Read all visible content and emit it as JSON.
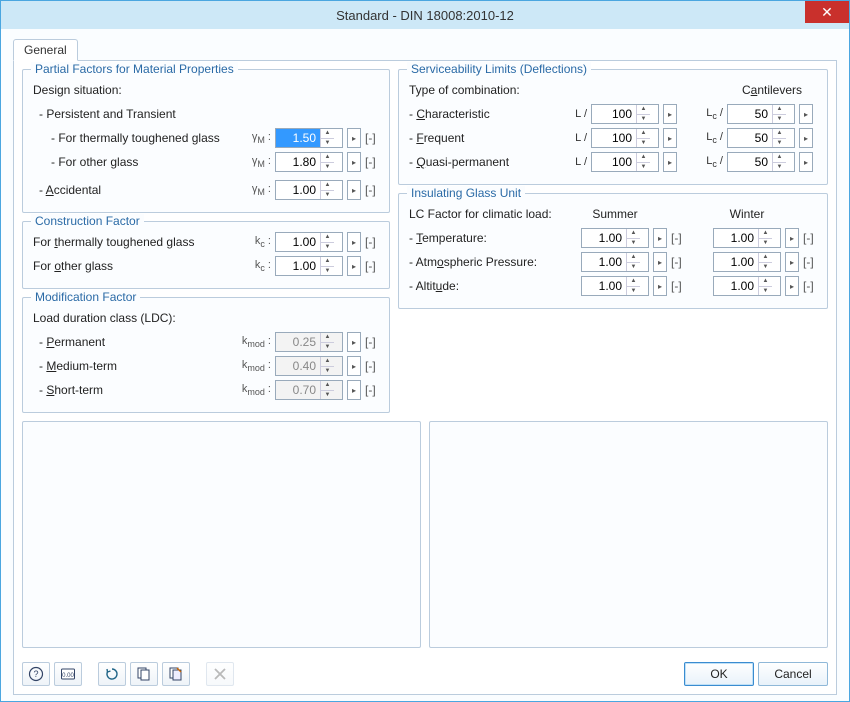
{
  "title": "Standard - DIN 18008:2010-12",
  "tabs": {
    "general": "General"
  },
  "partial": {
    "title": "Partial Factors for Material Properties",
    "design_situation": "Design situation:",
    "persistent": "- Persistent and Transient",
    "thermal_label": "- For thermally toughened glass",
    "thermal_value": "1.50",
    "other_label": "- For other glass",
    "other_value": "1.80",
    "accidental_label": "- Accidental",
    "accidental_value": "1.00",
    "sym": "γM :",
    "unit": "[-]"
  },
  "construction": {
    "title": "Construction Factor",
    "thermal_label": "For thermally toughened glass",
    "thermal_value": "1.00",
    "other_label": "For other glass",
    "other_value": "1.00",
    "sym": "kc :",
    "unit": "[-]"
  },
  "modification": {
    "title": "Modification Factor",
    "ldc": "Load duration class (LDC):",
    "perm_label": "- Permanent",
    "perm_value": "0.25",
    "med_label": "- Medium-term",
    "med_value": "0.40",
    "short_label": "- Short-term",
    "short_value": "0.70",
    "sym": "kmod :",
    "unit": "[-]"
  },
  "service": {
    "title": "Serviceability Limits (Deflections)",
    "type_label": "Type of combination:",
    "cant_header": "Cantilevers",
    "char_label": "- Characteristic",
    "freq_label": "- Frequent",
    "quasi_label": "- Quasi-permanent",
    "L_pre": "L /",
    "Lc_pre": "Lc /",
    "char_L": "100",
    "char_Lc": "50",
    "freq_L": "100",
    "freq_Lc": "50",
    "quasi_L": "100",
    "quasi_Lc": "50",
    "unit": "[-]"
  },
  "igu": {
    "title": "Insulating Glass Unit",
    "lc_label": "LC Factor for climatic load:",
    "summer": "Summer",
    "winter": "Winter",
    "temp_label": "- Temperature:",
    "atm_label": "- Atmospheric Pressure:",
    "alt_label": "- Altitude:",
    "temp_s": "1.00",
    "temp_w": "1.00",
    "atm_s": "1.00",
    "atm_w": "1.00",
    "alt_s": "1.00",
    "alt_w": "1.00",
    "unit": "[-]"
  },
  "footer": {
    "ok": "OK",
    "cancel": "Cancel"
  }
}
